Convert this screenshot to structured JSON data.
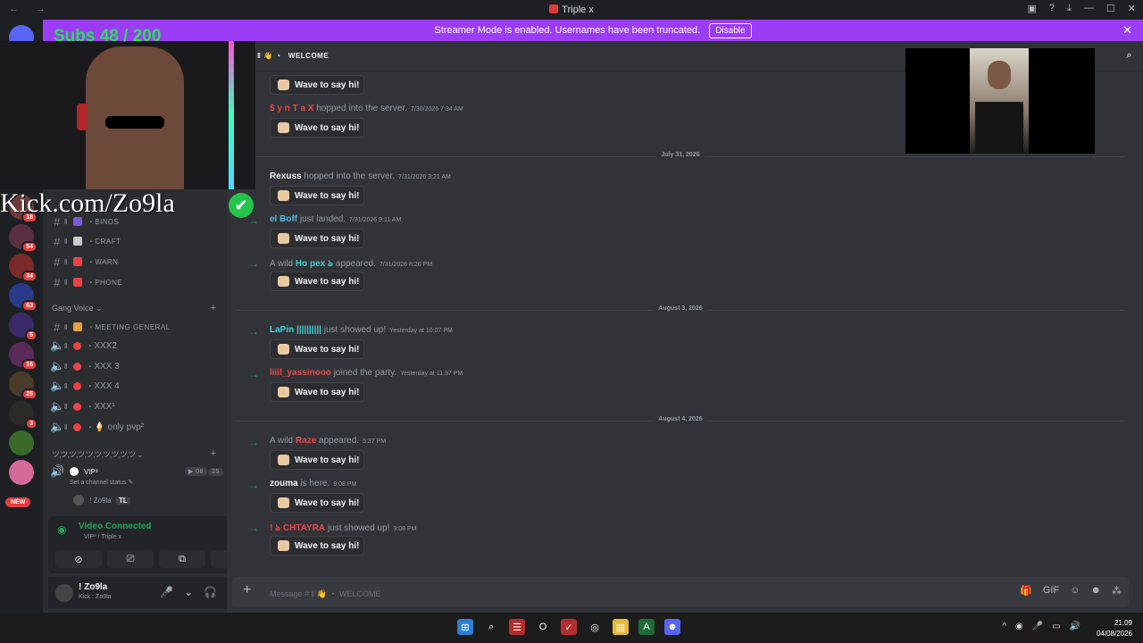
{
  "window": {
    "title": "Triple x",
    "nav": "← →",
    "controls": [
      "▣",
      "?",
      "⤓",
      "—",
      "☐",
      "✕"
    ]
  },
  "banner": {
    "text": "Streamer Mode is enabled. Usernames have been truncated.",
    "button": "Disable",
    "close": "✕"
  },
  "guilds": {
    "home_badge": "329",
    "badges": [
      "18",
      "54",
      "34",
      "63",
      "5",
      "16",
      "25",
      "3"
    ],
    "new_label": "NEW"
  },
  "channels": {
    "text": [
      {
        "name": "BINDS",
        "color": "#7a5ad6"
      },
      {
        "name": "CRAFT",
        "color": "#cccccc"
      },
      {
        "name": "WARN",
        "color": "#ed4245"
      },
      {
        "name": "PHONE",
        "color": "#ed4245"
      }
    ],
    "gang_voice_label": "Gang Voice ⌄",
    "plus": "+",
    "voice": [
      {
        "name": "MEETING GENERAL",
        "emoji_color": "#e6a23c"
      },
      {
        "name": "XXX2"
      },
      {
        "name": "XXX 3"
      },
      {
        "name": "XXX 4"
      },
      {
        "name": "XXX¹"
      },
      {
        "name": "🍦 only pvp²"
      }
    ],
    "category2_label": "ツ,ツ,ツ,ツ,ツ,ツ,ツ,ツ,ツ,ツ ⌄",
    "vip": {
      "name": "VIP³",
      "video_count": "08",
      "user_count": "25"
    },
    "channel_status": "Set a channel status ✎",
    "member": "! Zo9la",
    "member_tag": "TL"
  },
  "voice_panel": {
    "title": "Video Connected",
    "subtitle": "VIP³ / Triple x",
    "buttons": [
      "⊘",
      "⎚",
      "⧉",
      "✦"
    ]
  },
  "user": {
    "name": "! Zo9la",
    "status": "Kick : Zo9la",
    "icons": [
      "🎤",
      "⌄",
      "🎧",
      "⌄",
      "⚙"
    ]
  },
  "header": {
    "channel": "WELCOME"
  },
  "overlay": {
    "subs": "Subs 48 / 200",
    "kick": "Kick.com/Zo9la",
    "check": "✔"
  },
  "messages": [
    {
      "prefix": "",
      "user": "",
      "user_color": "#dbdee1",
      "text": "",
      "ts": "",
      "wave": "Wave to say hi!",
      "arrow": false
    },
    {
      "prefix": "",
      "user": "$ y n T a X",
      "user_color": "#e84a4a",
      "text": " hopped into the server.",
      "ts": "7/30/2026 7:34 AM",
      "wave": "Wave to say hi!",
      "arrow": false
    },
    {
      "divider": "July 31, 2026"
    },
    {
      "prefix": "",
      "user": "Rexuss",
      "user_color": "#f2f3f5",
      "text": " hopped into the server.",
      "ts": "7/31/2026 3:21 AM",
      "wave": "Wave to say hi!",
      "arrow": false
    },
    {
      "prefix": "",
      "user": "el Boff",
      "user_color": "#4fb6e3",
      "text": " just landed.",
      "ts": "7/31/2026 9:11 AM",
      "wave": "Wave to say hi!",
      "arrow": true
    },
    {
      "prefix": "A wild ",
      "user": "Ho pex ঌ",
      "user_color": "#3fd3d6",
      "text": " appeared.",
      "ts": "7/31/2026 8:26 PM",
      "wave": "Wave to say hi!",
      "arrow": true
    },
    {
      "divider": "August 3, 2026"
    },
    {
      "prefix": "",
      "user": "LaPin ||||||||||",
      "user_color": "#3fd3d6",
      "text": " just showed up!",
      "ts": "Yesterday at 10:07 PM",
      "wave": "Wave to say hi!",
      "arrow": true
    },
    {
      "prefix": "",
      "user": "liiil_yassinooo",
      "user_color": "#e84a4a",
      "text": " joined the party.",
      "ts": "Yesterday at 11:37 PM",
      "wave": "Wave to say hi!",
      "arrow": true
    },
    {
      "divider": "August 4, 2026"
    },
    {
      "prefix": "A wild ",
      "user": "Raze",
      "user_color": "#e84a4a",
      "text": " appeared.",
      "ts": "5:37 PM",
      "wave": "Wave to say hi!",
      "arrow": true
    },
    {
      "prefix": "",
      "user": "zouma",
      "user_color": "#f2f3f5",
      "text": " is here.",
      "ts": "9:08 PM",
      "wave": "Wave to say hi!",
      "arrow": true
    },
    {
      "prefix": "",
      "user": "! ঌ CHTAYRA",
      "user_color": "#e84a4a",
      "text": " just showed up!",
      "ts": "9:08 PM",
      "wave": "Wave to say hi!",
      "arrow": true
    }
  ],
  "composer": {
    "placeholder": "Message # ‖ 👋 ・ WELCOME",
    "icons": [
      "🎁",
      "GIF",
      "☺",
      "☻",
      "⁂"
    ]
  },
  "taskbar": {
    "apps": [
      "⊞",
      "⌕",
      "☰",
      "O",
      "✓",
      "◎",
      "▤",
      "A",
      "☻"
    ],
    "tray": [
      "^",
      "◉",
      "🎤",
      "▭",
      "🔊"
    ],
    "time": "21:09",
    "date": "04/08/2026"
  }
}
